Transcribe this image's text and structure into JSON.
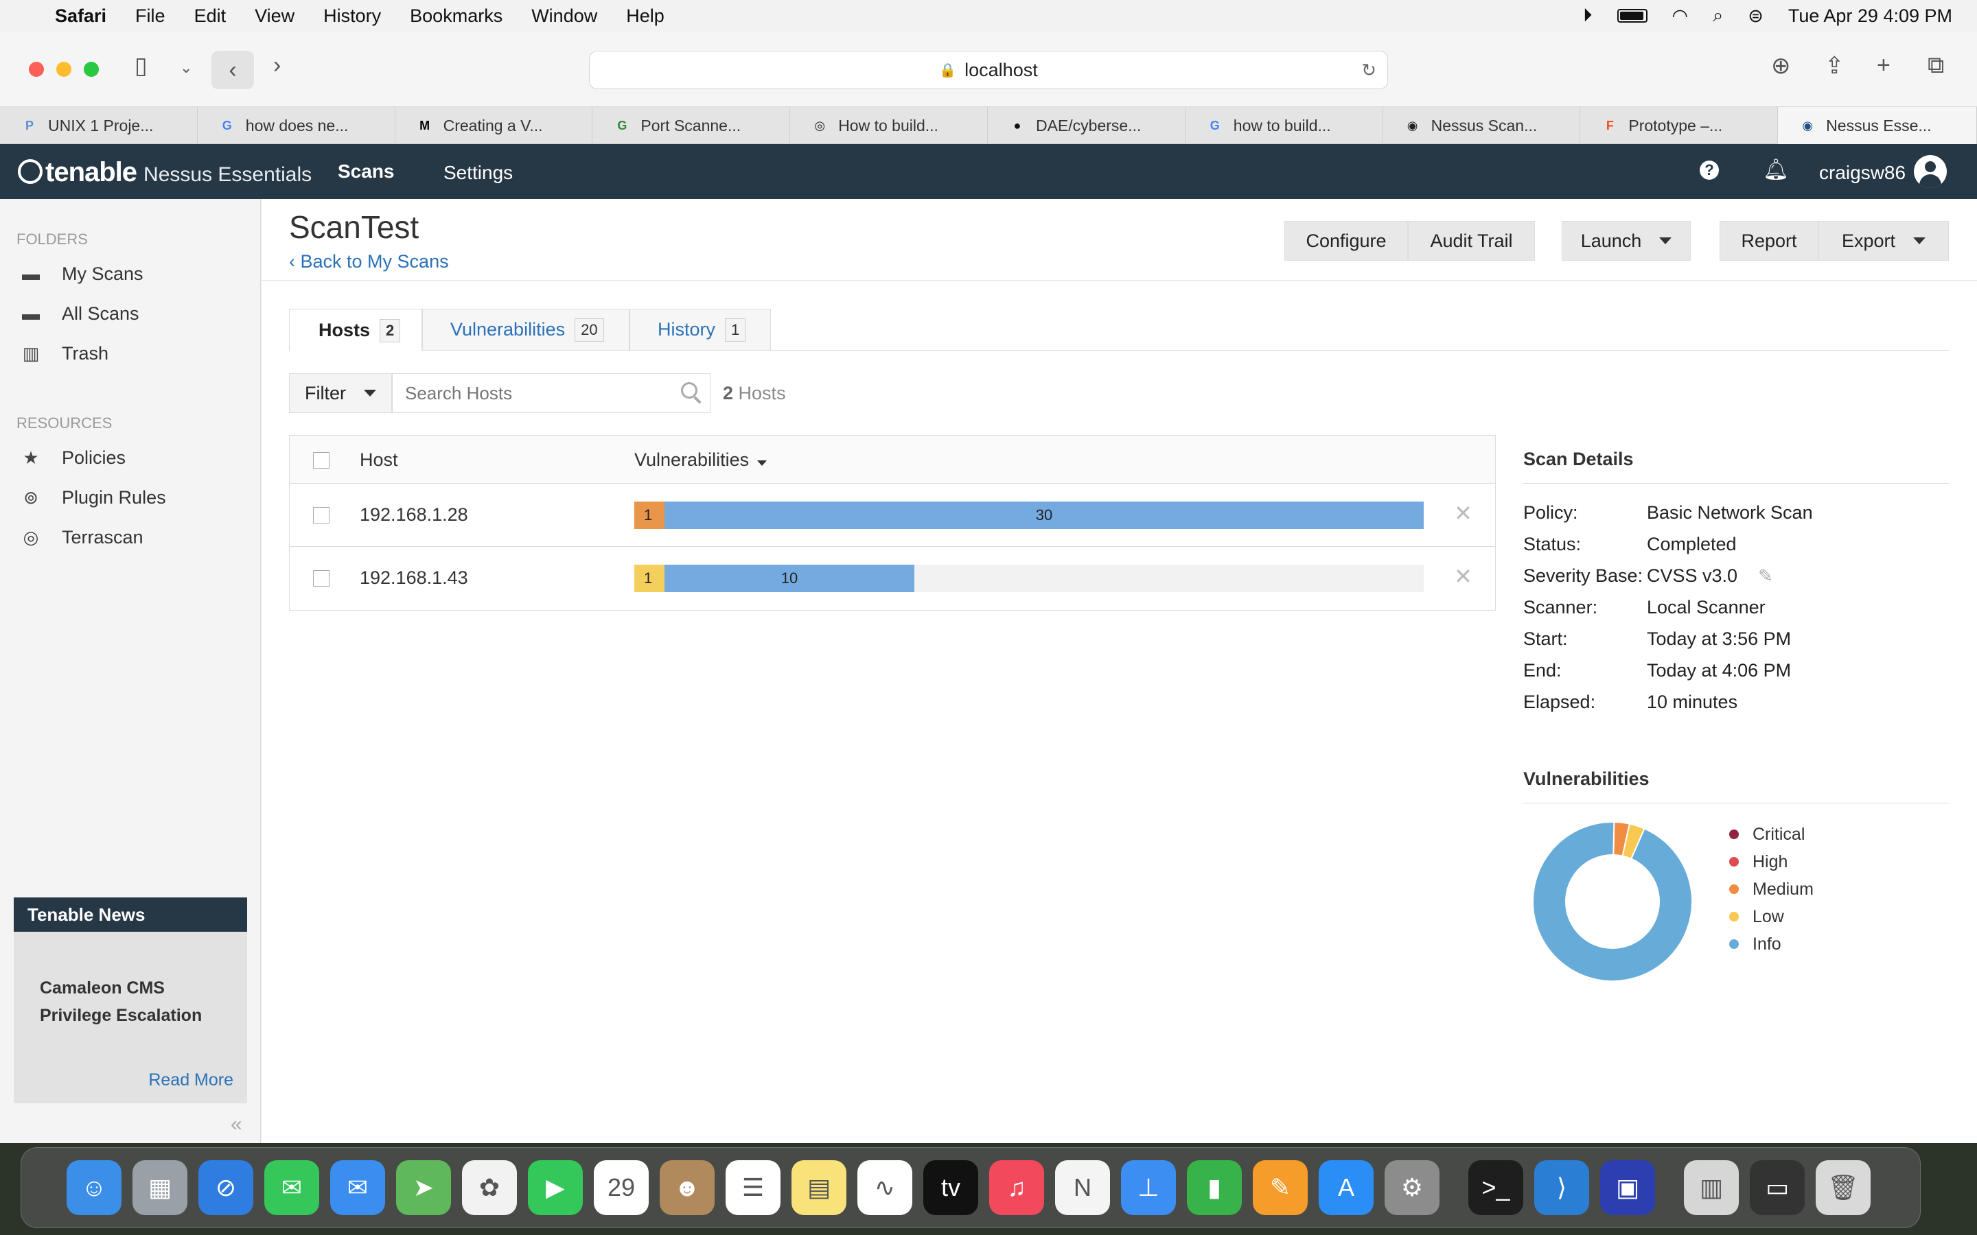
{
  "menubar": {
    "items": [
      "Safari",
      "File",
      "Edit",
      "View",
      "History",
      "Bookmarks",
      "Window",
      "Help"
    ],
    "clock": "Tue Apr 29  4:09 PM"
  },
  "browser": {
    "address": "localhost",
    "tabs": [
      {
        "label": "UNIX 1 Proje...",
        "icon": "P",
        "color": "#5b8fd6"
      },
      {
        "label": "how does ne...",
        "icon": "G",
        "color": "#4285f4"
      },
      {
        "label": "Creating a V...",
        "icon": "M",
        "color": "#000000"
      },
      {
        "label": "Port Scanne...",
        "icon": "G",
        "color": "#2e8b3d"
      },
      {
        "label": "How to build...",
        "icon": "◎",
        "color": "#222222"
      },
      {
        "label": "DAE/cyberse...",
        "icon": "●",
        "color": "#111111"
      },
      {
        "label": "how to build...",
        "icon": "G",
        "color": "#4285f4"
      },
      {
        "label": "Nessus Scan...",
        "icon": "◉",
        "color": "#222222"
      },
      {
        "label": "Prototype –...",
        "icon": "F",
        "color": "#f24e1e"
      },
      {
        "label": "Nessus Esse...",
        "icon": "◉",
        "color": "#1f4f86"
      }
    ]
  },
  "app": {
    "brand": "tenable",
    "product": "Nessus Essentials",
    "nav": [
      "Scans",
      "Settings"
    ],
    "user": "craigsw86"
  },
  "sidebar": {
    "folders_title": "FOLDERS",
    "folders": [
      "My Scans",
      "All Scans",
      "Trash"
    ],
    "resources_title": "RESOURCES",
    "resources": [
      "Policies",
      "Plugin Rules",
      "Terrascan"
    ],
    "news": {
      "title": "Tenable News",
      "headline": "Camaleon CMS Privilege Escalation",
      "link": "Read More"
    },
    "collapse": "«"
  },
  "scan": {
    "title": "ScanTest",
    "back": "Back to My Scans",
    "actions": {
      "configure": "Configure",
      "audit": "Audit Trail",
      "launch": "Launch",
      "report": "Report",
      "export": "Export"
    },
    "tabs": [
      {
        "label": "Hosts",
        "count": "2"
      },
      {
        "label": "Vulnerabilities",
        "count": "20"
      },
      {
        "label": "History",
        "count": "1"
      }
    ],
    "filter": "Filter",
    "search_placeholder": "Search Hosts",
    "hosts_count": "2",
    "hosts_word": "Hosts",
    "columns": {
      "host": "Host",
      "vulns": "Vulnerabilities"
    },
    "hosts": [
      {
        "ip": "192.168.1.28",
        "first_label": "1",
        "first_color": "#e9954a",
        "info_label": "30",
        "first": 1,
        "info": 30
      },
      {
        "ip": "192.168.1.43",
        "first_label": "1",
        "first_color": "#f5cf5b",
        "info_label": "10",
        "first": 1,
        "info": 10
      }
    ]
  },
  "details": {
    "title": "Scan Details",
    "rows": [
      {
        "label": "Policy:",
        "value": "Basic Network Scan"
      },
      {
        "label": "Status:",
        "value": "Completed"
      },
      {
        "label": "Severity Base:",
        "value": "CVSS v3.0"
      },
      {
        "label": "Scanner:",
        "value": "Local Scanner"
      },
      {
        "label": "Start:",
        "value": "Today at 3:56 PM"
      },
      {
        "label": "End:",
        "value": "Today at 4:06 PM"
      },
      {
        "label": "Elapsed:",
        "value": "10 minutes"
      }
    ]
  },
  "vulnerabilities": {
    "title": "Vulnerabilities",
    "legend": [
      {
        "label": "Critical",
        "color": "#91243e"
      },
      {
        "label": "High",
        "color": "#dd4b50"
      },
      {
        "label": "Medium",
        "color": "#f18c43"
      },
      {
        "label": "Low",
        "color": "#f8c851"
      },
      {
        "label": "Info",
        "color": "#67acd8"
      }
    ],
    "donut": [
      {
        "name": "Critical",
        "value": 0
      },
      {
        "name": "High",
        "value": 0
      },
      {
        "name": "Medium",
        "value": 1
      },
      {
        "name": "Low",
        "value": 1
      },
      {
        "name": "Info",
        "value": 30
      }
    ]
  },
  "dock": {
    "apps": [
      {
        "name": "finder",
        "color": "#3b8fe8",
        "glyph": "☺"
      },
      {
        "name": "launchpad",
        "color": "#9aa0a8",
        "glyph": "▦"
      },
      {
        "name": "safari",
        "color": "#2f7de1",
        "glyph": "⊘"
      },
      {
        "name": "messages",
        "color": "#35c759",
        "glyph": "✉"
      },
      {
        "name": "mail",
        "color": "#3a8ef0",
        "glyph": "✉"
      },
      {
        "name": "maps",
        "color": "#5fb85a",
        "glyph": "➤"
      },
      {
        "name": "photos",
        "color": "#f2f2f2",
        "glyph": "✿"
      },
      {
        "name": "facetime",
        "color": "#34c759",
        "glyph": "▶"
      },
      {
        "name": "calendar",
        "color": "#ffffff",
        "glyph": "29"
      },
      {
        "name": "contacts",
        "color": "#b08a5c",
        "glyph": "☻"
      },
      {
        "name": "reminders",
        "color": "#ffffff",
        "glyph": "☰"
      },
      {
        "name": "notes",
        "color": "#f9e27a",
        "glyph": "▤"
      },
      {
        "name": "freeform",
        "color": "#ffffff",
        "glyph": "∿"
      },
      {
        "name": "tv",
        "color": "#111111",
        "glyph": "tv"
      },
      {
        "name": "music",
        "color": "#f24a5c",
        "glyph": "♫"
      },
      {
        "name": "news",
        "color": "#f4f4f4",
        "glyph": "N"
      },
      {
        "name": "keynote",
        "color": "#3d8ef2",
        "glyph": "⊥"
      },
      {
        "name": "numbers",
        "color": "#37b34a",
        "glyph": "▮"
      },
      {
        "name": "pages",
        "color": "#f59c2b",
        "glyph": "✎"
      },
      {
        "name": "app-store",
        "color": "#2b8ef6",
        "glyph": "A"
      },
      {
        "name": "system-settings",
        "color": "#8c8c8c",
        "glyph": "⚙"
      },
      {
        "name": "terminal",
        "color": "#1e1e1e",
        "glyph": ">_"
      },
      {
        "name": "vscode",
        "color": "#2a7fd4",
        "glyph": "⟩"
      },
      {
        "name": "nessus-agent",
        "color": "#2d3fb0",
        "glyph": "▣"
      },
      {
        "name": "preview",
        "color": "#d6d6d6",
        "glyph": "▥"
      },
      {
        "name": "screen-recording",
        "color": "#333333",
        "glyph": "▭"
      },
      {
        "name": "trash",
        "color": "#d9d9d9",
        "glyph": "🗑"
      }
    ]
  }
}
